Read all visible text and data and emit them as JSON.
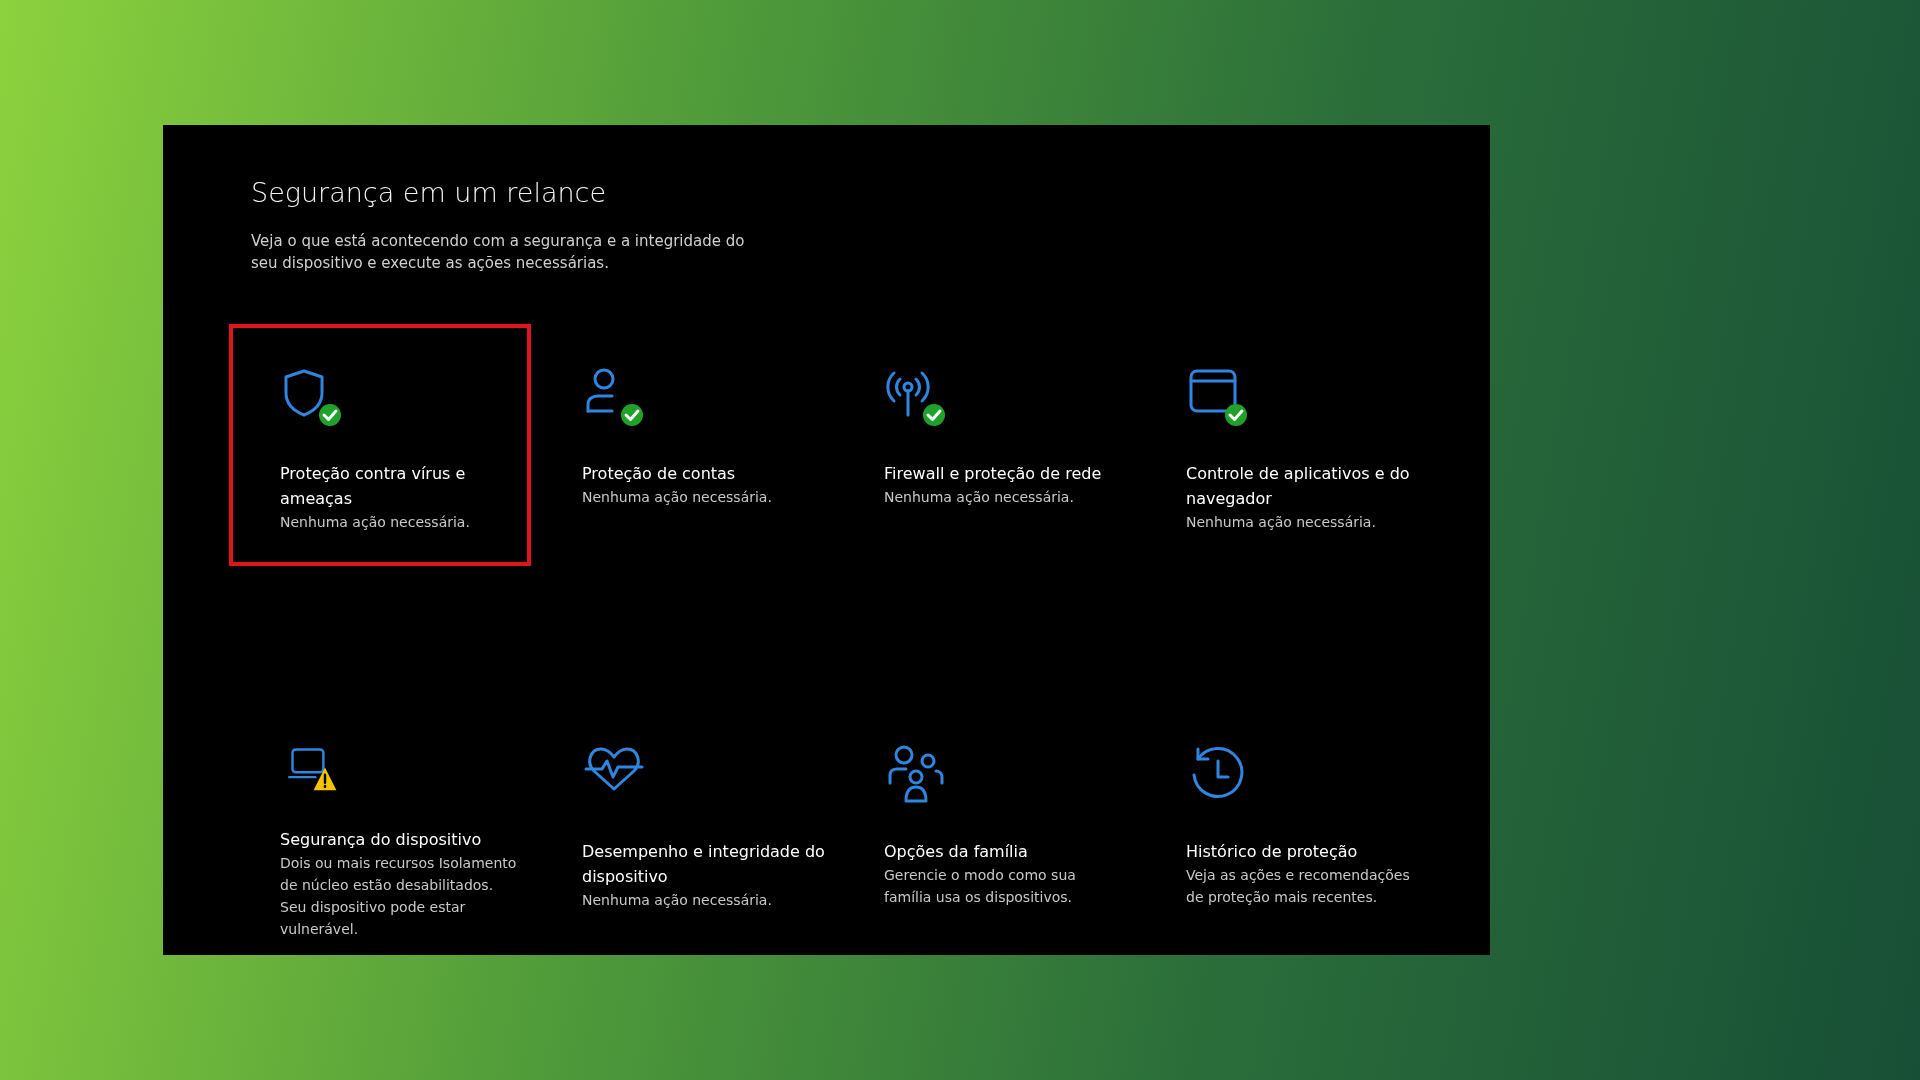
{
  "page": {
    "title": "Segurança em um relance",
    "description": "Veja o que está acontecendo com a segurança e a integridade do seu dispositivo e execute as ações necessárias."
  },
  "tiles": [
    {
      "kind": "shield",
      "checked": true,
      "warning": false,
      "highlighted": true,
      "name": "Proteção contra vírus e ameaças",
      "detail": "Nenhuma ação necessária."
    },
    {
      "kind": "person",
      "checked": true,
      "warning": false,
      "highlighted": false,
      "name": "Proteção de contas",
      "detail": "Nenhuma ação necessária."
    },
    {
      "kind": "antenna",
      "checked": true,
      "warning": false,
      "highlighted": false,
      "name": "Firewall e proteção de rede",
      "detail": "Nenhuma ação necessária."
    },
    {
      "kind": "window",
      "checked": true,
      "warning": false,
      "highlighted": false,
      "name": "Controle de aplicativos e do navegador",
      "detail": "Nenhuma ação necessária."
    },
    {
      "kind": "laptop",
      "checked": false,
      "warning": true,
      "highlighted": false,
      "name": "Segurança do dispositivo",
      "detail": "Dois ou mais recursos Isolamento de núcleo estão desabilitados.  Seu dispositivo pode estar vulnerável."
    },
    {
      "kind": "heart",
      "checked": false,
      "warning": false,
      "highlighted": false,
      "name": "Desempenho e integridade do dispositivo",
      "detail": "Nenhuma ação necessária."
    },
    {
      "kind": "family",
      "checked": false,
      "warning": false,
      "highlighted": false,
      "name": "Opções da família",
      "detail": "Gerencie o modo como sua família usa os dispositivos."
    },
    {
      "kind": "history",
      "checked": false,
      "warning": false,
      "highlighted": false,
      "name": "Histórico de proteção",
      "detail": "Veja as ações e recomendações de proteção mais recentes."
    }
  ]
}
